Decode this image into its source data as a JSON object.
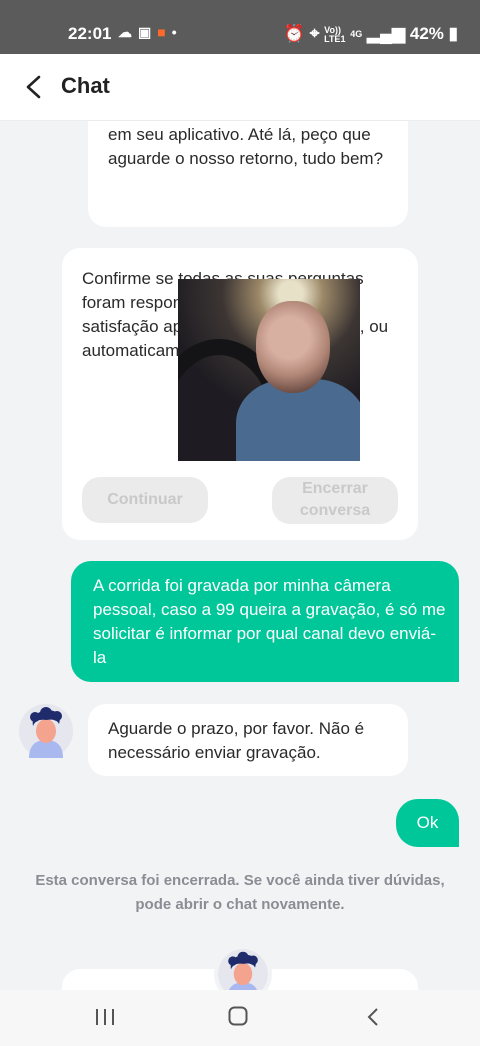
{
  "status_bar": {
    "time": "22:01",
    "left_icons": [
      "cloud-icon",
      "gallery-icon",
      "video-icon",
      "dot-icon"
    ],
    "network_line1": "Vo))",
    "network_line2": "LTE1",
    "network_gen": "4G",
    "battery": "42%"
  },
  "header": {
    "title": "Chat"
  },
  "messages": [
    {
      "from": "agent",
      "text": "em seu app e no e-mail cadastrado em seu aplicativo. Até lá, peço que aguarde o nosso retorno, tudo bem?"
    },
    {
      "from": "agent",
      "text": "Confirme se todas as suas perguntas foram respondidas ivo, por favor, re satisfação ap Caso contrár minuto(s), ou automaticam contato!",
      "buttons": [
        "Continuar",
        "Encerrar conversa"
      ]
    },
    {
      "from": "user",
      "text": "A corrida foi gravada por minha câmera pessoal,  caso a 99 queira a gravação,  é só me solicitar é informar por qual canal devo enviá-la"
    },
    {
      "from": "agent",
      "text": "Aguarde o prazo, por favor. Não é necessário enviar gravação."
    },
    {
      "from": "user",
      "text": "Ok"
    }
  ],
  "closed_note": "Esta conversa foi encerrada. Se você ainda tiver dúvidas, pode abrir o chat novamente.",
  "colors": {
    "accent": "#00c79a",
    "background": "#f2f3f5",
    "status_bar": "#5b5b5b"
  },
  "nav_bar": [
    "recents-icon",
    "home-icon",
    "back-icon"
  ]
}
